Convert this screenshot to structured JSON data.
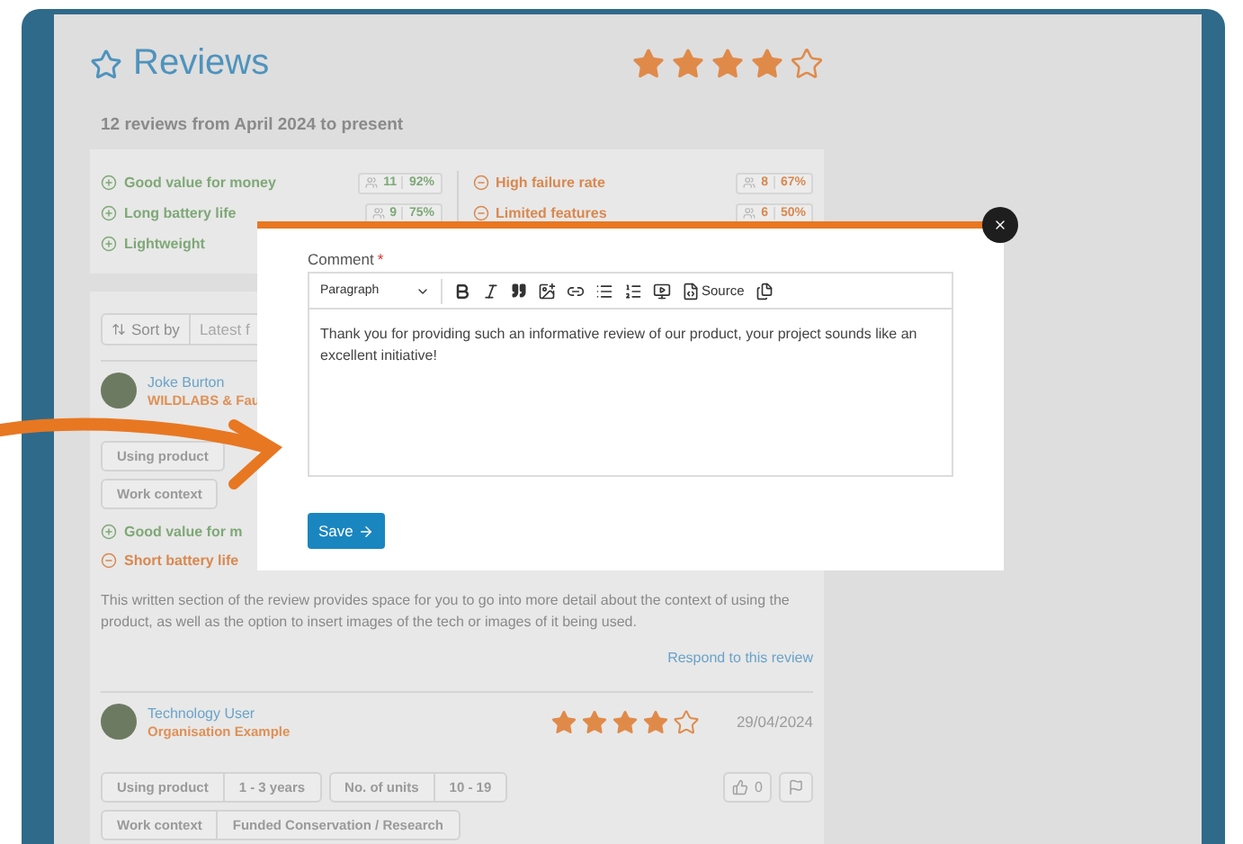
{
  "header": {
    "title": "Reviews",
    "stars": 4
  },
  "summary_line": "12 reviews from April 2024 to present",
  "summary": {
    "pros": [
      {
        "label": "Good value for money",
        "count": "11",
        "percent": "92%"
      },
      {
        "label": "Long battery life",
        "count": "9",
        "percent": "75%"
      },
      {
        "label": "Lightweight"
      }
    ],
    "cons": [
      {
        "label": "High failure rate",
        "count": "8",
        "percent": "67%"
      },
      {
        "label": "Limited features",
        "count": "6",
        "percent": "50%"
      }
    ]
  },
  "sort": {
    "label": "Sort by",
    "value": "Latest f"
  },
  "reviews": [
    {
      "name": "Joke Burton",
      "organisation": "WILDLABS & Fau",
      "chip_rows": [
        [
          {
            "label": "Using product"
          }
        ],
        [
          {
            "label": "Work context"
          }
        ]
      ],
      "pros": [
        "Good value for m"
      ],
      "cons": [
        "Short battery life"
      ],
      "body": "This written section of the review provides space for you to go into more detail about the context of using the product, as well as the option to insert images of the tech or images of it being used.",
      "link": "Respond to this review"
    },
    {
      "name": "Technology User",
      "organisation": "Organisation Example",
      "stars": 4,
      "date": "29/04/2024",
      "chip_rows": [
        [
          {
            "label": "Using product",
            "value": "1 - 3 years"
          },
          {
            "label": "No. of units",
            "value": "10 - 19"
          }
        ],
        [
          {
            "label": "Work context",
            "value": "Funded Conservation / Research"
          }
        ]
      ],
      "likes": "0"
    }
  ],
  "modal": {
    "label": "Comment",
    "required_mark": "*",
    "block_style": "Paragraph",
    "source": "Source",
    "value": "Thank you for providing such an informative review of our product, your project sounds like an excellent initiative!",
    "button": "Save"
  }
}
